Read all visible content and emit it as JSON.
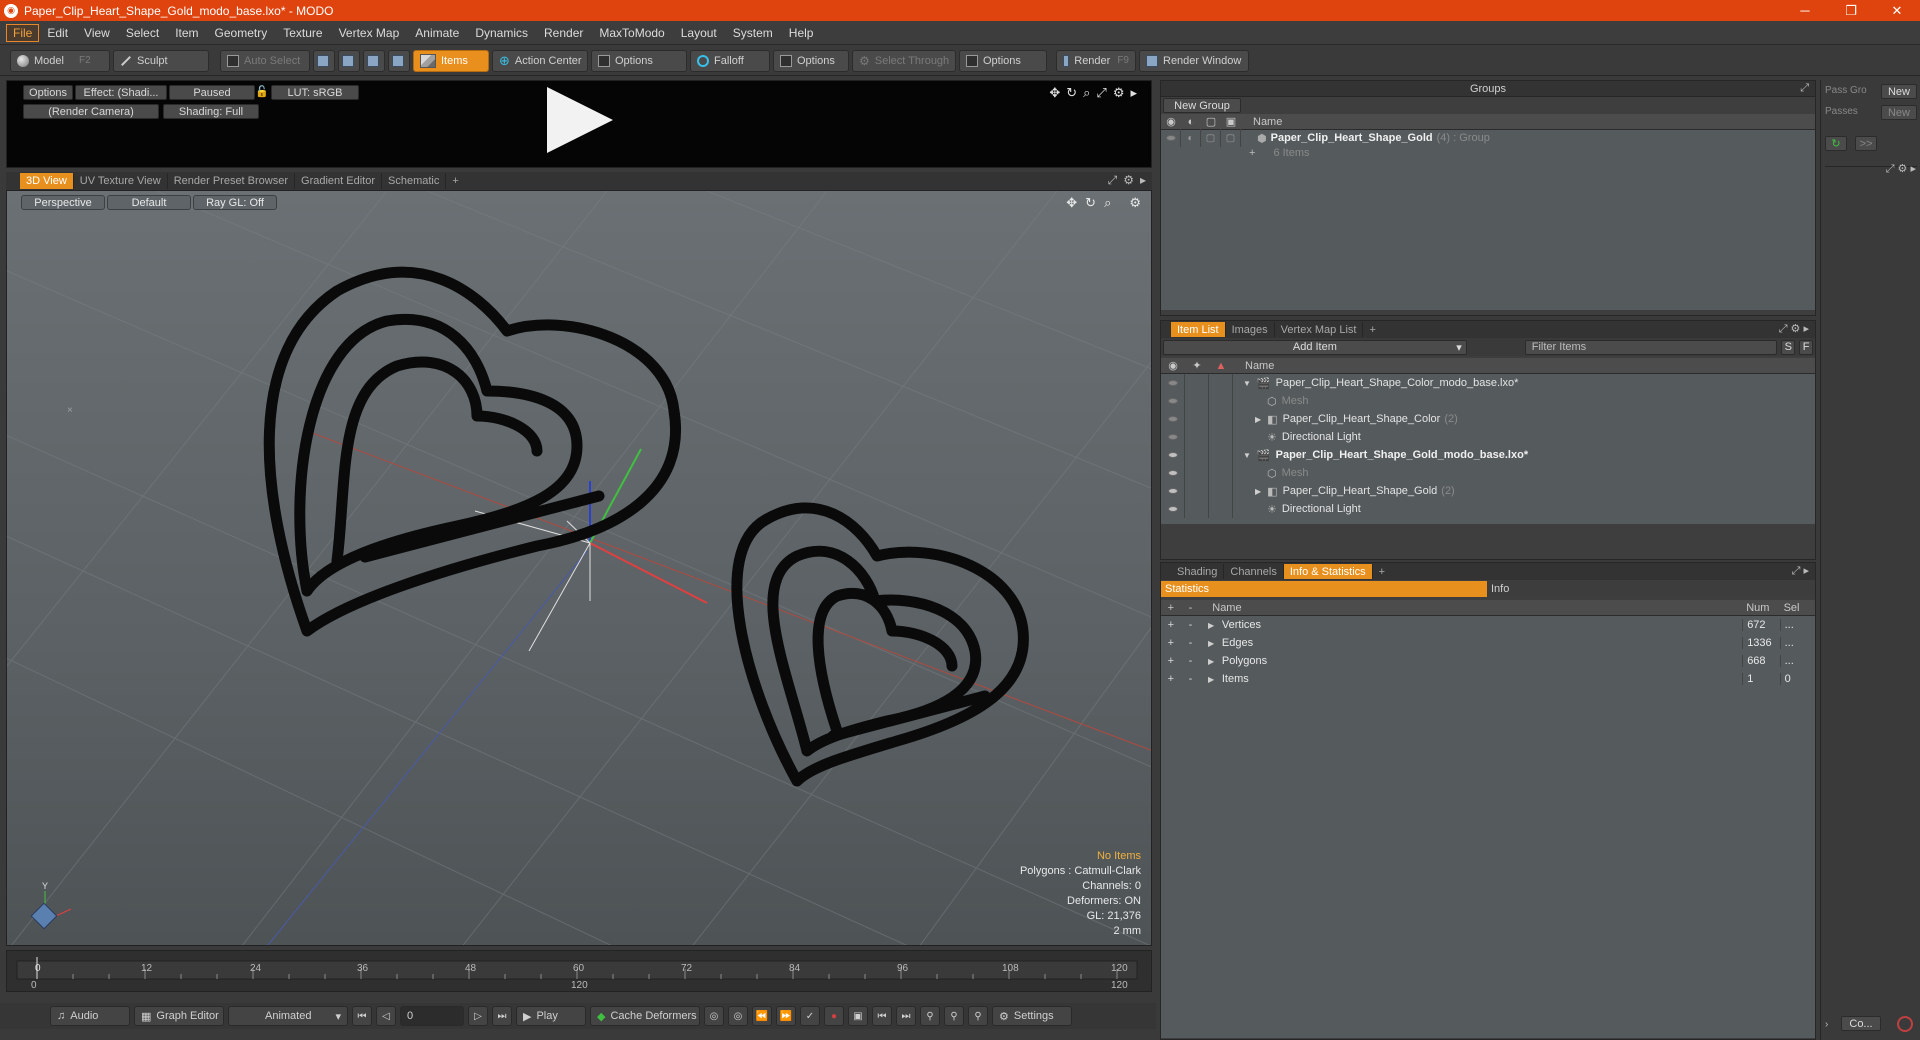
{
  "window": {
    "title": "Paper_Clip_Heart_Shape_Gold_modo_base.lxo* - MODO",
    "minimize": "─",
    "restore": "❐",
    "close": "✕"
  },
  "menu": [
    "File",
    "Edit",
    "View",
    "Select",
    "Item",
    "Geometry",
    "Texture",
    "Vertex Map",
    "Animate",
    "Dynamics",
    "Render",
    "MaxToModo",
    "Layout",
    "System",
    "Help"
  ],
  "toolbar": {
    "model": "Model",
    "model_key": "F2",
    "sculpt": "Sculpt",
    "auto_select": "Auto Select",
    "items": "Items",
    "action_center": "Action Center",
    "options1": "Options",
    "falloff": "Falloff",
    "options2": "Options",
    "select_through": "Select Through",
    "options3": "Options",
    "render": "Render",
    "render_key": "F9",
    "render_window": "Render Window"
  },
  "preview": {
    "options": "Options",
    "effect": "Effect: (Shadi...",
    "paused": "Paused",
    "lut": "LUT: sRGB",
    "camera": "(Render Camera)",
    "shading": "Shading: Full"
  },
  "view_tabs": [
    "3D View",
    "UV Texture View",
    "Render Preset Browser",
    "Gradient Editor",
    "Schematic",
    "+"
  ],
  "viewport": {
    "perspective": "Perspective",
    "default": "Default",
    "raygl": "Ray GL: Off",
    "info": {
      "no_items": "No Items",
      "polygons": "Polygons : Catmull-Clark",
      "channels": "Channels: 0",
      "deformers": "Deformers: ON",
      "gl": "GL: 21,376",
      "scale": "2 mm"
    }
  },
  "timeline": {
    "ticks": [
      "0",
      "12",
      "24",
      "36",
      "48",
      "60",
      "72",
      "84",
      "96",
      "108",
      "120"
    ],
    "sub_ticks": [
      "0",
      "120",
      "120"
    ]
  },
  "bottombar": {
    "audio": "Audio",
    "graph_editor": "Graph Editor",
    "animated": "Animated",
    "frame": "0",
    "play": "Play",
    "cache_deformers": "Cache Deformers",
    "settings": "Settings"
  },
  "groups": {
    "title": "Groups",
    "new_group": "New Group",
    "col_name": "Name",
    "item_name": "Paper_Clip_Heart_Shape_Gold",
    "item_suffix": "(4) : Group",
    "item_count": "6 Items"
  },
  "item_list": {
    "tabs": [
      "Item List",
      "Images",
      "Vertex Map List",
      "+"
    ],
    "add_item": "Add Item",
    "filter": "Filter Items",
    "s": "S",
    "f": "F",
    "col_name": "Name",
    "rows": [
      {
        "label": "Paper_Clip_Heart_Shape_Color_modo_base.lxo*",
        "extra": "",
        "indent": 0,
        "style": "normal"
      },
      {
        "label": "Mesh",
        "extra": "",
        "indent": 2,
        "style": "muted"
      },
      {
        "label": "Paper_Clip_Heart_Shape_Color",
        "extra": "(2)",
        "indent": 1,
        "style": "normal"
      },
      {
        "label": "Directional Light",
        "extra": "",
        "indent": 2,
        "style": "normal"
      },
      {
        "label": "Paper_Clip_Heart_Shape_Gold_modo_base.lxo*",
        "extra": "",
        "indent": 0,
        "style": "bold"
      },
      {
        "label": "Mesh",
        "extra": "",
        "indent": 2,
        "style": "muted"
      },
      {
        "label": "Paper_Clip_Heart_Shape_Gold",
        "extra": "(2)",
        "indent": 1,
        "style": "normal"
      },
      {
        "label": "Directional Light",
        "extra": "",
        "indent": 2,
        "style": "normal"
      }
    ]
  },
  "stats": {
    "tabs": [
      "Shading",
      "Channels",
      "Info & Statistics",
      "+"
    ],
    "statistics": "Statistics",
    "info": "Info",
    "headers": {
      "name": "Name",
      "num": "Num",
      "sel": "Sel"
    },
    "rows": [
      {
        "name": "Vertices",
        "num": "672",
        "sel": "..."
      },
      {
        "name": "Edges",
        "num": "1336",
        "sel": "..."
      },
      {
        "name": "Polygons",
        "num": "668",
        "sel": "..."
      },
      {
        "name": "Items",
        "num": "1",
        "sel": "0"
      }
    ]
  },
  "far_right": {
    "pass_group": "Pass Gro",
    "passes": "Passes",
    "new1": "New",
    "new2": "New",
    "expand": ">>",
    "bottom": "Co..."
  }
}
